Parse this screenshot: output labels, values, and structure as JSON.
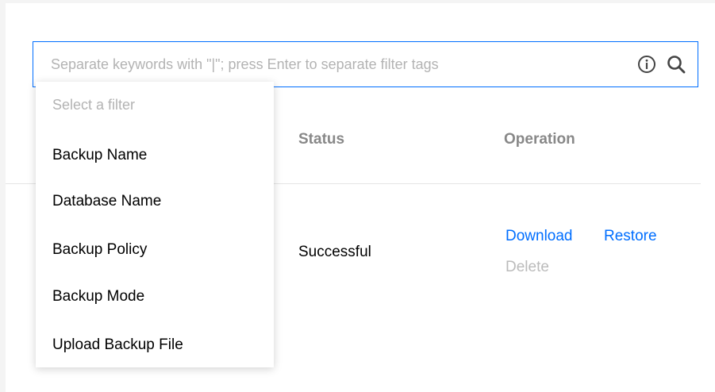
{
  "search": {
    "placeholder": "Separate keywords with \"|\"; press Enter to separate filter tags",
    "info_icon": "info-circle-icon",
    "search_icon": "magnifier-icon",
    "accent_color": "#006eff"
  },
  "table": {
    "columns": [
      "Status",
      "Operation"
    ],
    "rows": [
      {
        "status": "Successful",
        "operations": {
          "download": "Download",
          "restore": "Restore",
          "delete": "Delete"
        }
      }
    ]
  },
  "filter_dropdown": {
    "header": "Select a filter",
    "options": [
      "Backup Name",
      "Database Name",
      "Backup Policy",
      "Backup Mode",
      "Upload Backup File"
    ]
  }
}
